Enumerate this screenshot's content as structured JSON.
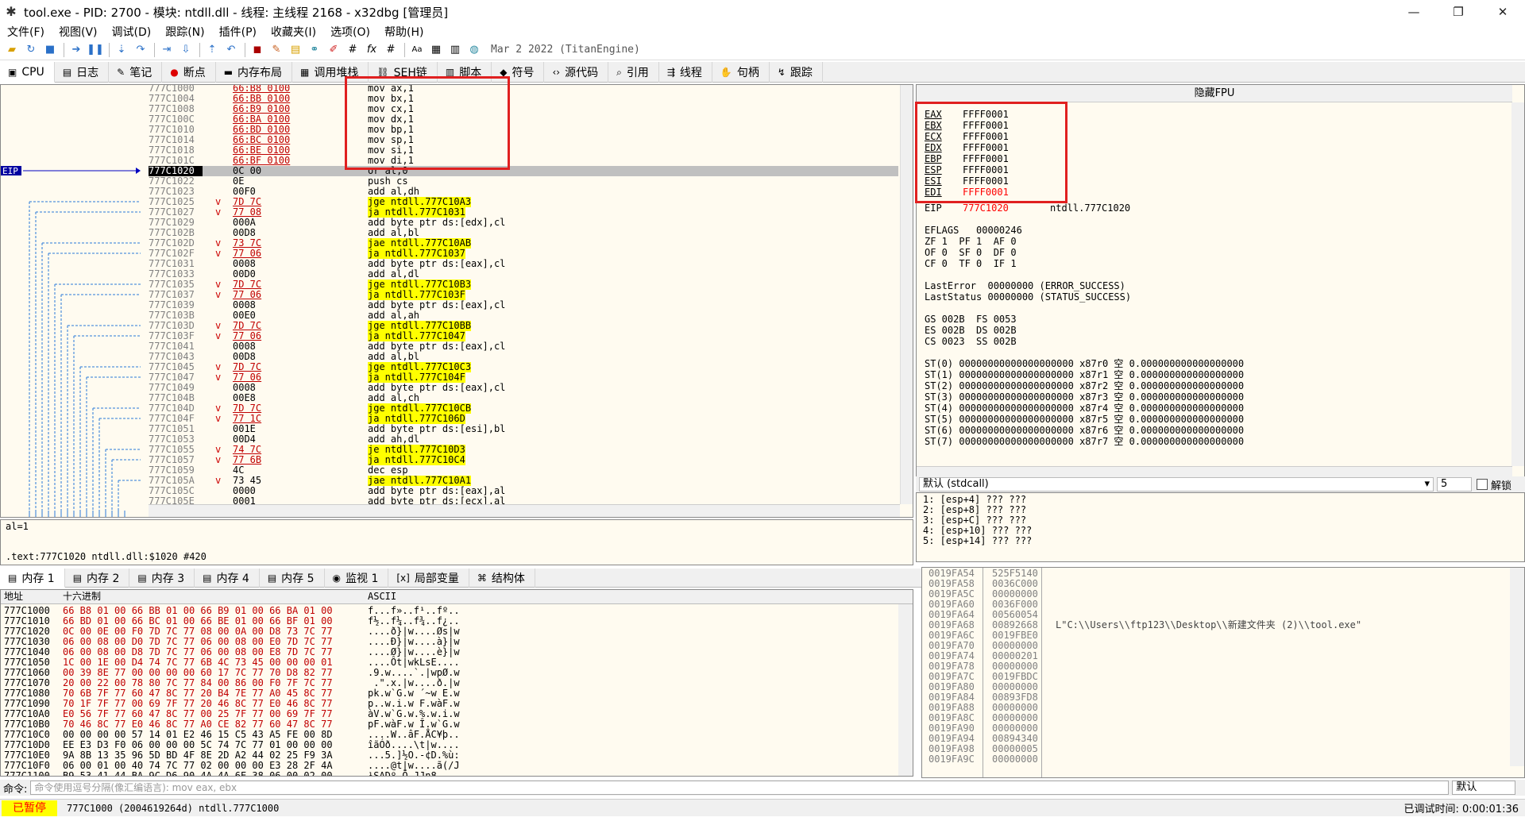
{
  "window": {
    "title": "tool.exe - PID: 2700 - 模块: ntdll.dll - 线程: 主线程 2168 - x32dbg [管理员]"
  },
  "menu": [
    "文件(F)",
    "视图(V)",
    "调试(D)",
    "跟踪(N)",
    "插件(P)",
    "收藏夹(I)",
    "选项(O)",
    "帮助(H)"
  ],
  "toolbar": {
    "build_date": "Mar 2 2022 (TitanEngine)"
  },
  "tabs": [
    {
      "label": "CPU",
      "icon": "cpu-icon"
    },
    {
      "label": "日志",
      "icon": "log-icon"
    },
    {
      "label": "笔记",
      "icon": "notes-icon"
    },
    {
      "label": "断点",
      "icon": "breakpoint-icon"
    },
    {
      "label": "内存布局",
      "icon": "memory-map-icon"
    },
    {
      "label": "调用堆栈",
      "icon": "callstack-icon"
    },
    {
      "label": "SEH链",
      "icon": "seh-icon"
    },
    {
      "label": "脚本",
      "icon": "script-icon"
    },
    {
      "label": "符号",
      "icon": "symbol-icon"
    },
    {
      "label": "源代码",
      "icon": "source-icon"
    },
    {
      "label": "引用",
      "icon": "reference-icon"
    },
    {
      "label": "线程",
      "icon": "thread-icon"
    },
    {
      "label": "句柄",
      "icon": "handle-icon"
    },
    {
      "label": "跟踪",
      "icon": "trace-icon"
    }
  ],
  "disasm": {
    "eip_label": "EIP",
    "rows": [
      {
        "addr": "777C1000",
        "arrow": "",
        "bytes": "66:B8 0100",
        "inst": "mov ax,1",
        "hl": true,
        "jmp": false
      },
      {
        "addr": "777C1004",
        "arrow": "",
        "bytes": "66:BB 0100",
        "inst": "mov bx,1",
        "hl": true,
        "jmp": false
      },
      {
        "addr": "777C1008",
        "arrow": "",
        "bytes": "66:B9 0100",
        "inst": "mov cx,1",
        "hl": true,
        "jmp": false
      },
      {
        "addr": "777C100C",
        "arrow": "",
        "bytes": "66:BA 0100",
        "inst": "mov dx,1",
        "hl": true,
        "jmp": false
      },
      {
        "addr": "777C1010",
        "arrow": "",
        "bytes": "66:BD 0100",
        "inst": "mov bp,1",
        "hl": true,
        "jmp": false
      },
      {
        "addr": "777C1014",
        "arrow": "",
        "bytes": "66:BC 0100",
        "inst": "mov sp,1",
        "hl": true,
        "jmp": false
      },
      {
        "addr": "777C1018",
        "arrow": "",
        "bytes": "66:BE 0100",
        "inst": "mov si,1",
        "hl": true,
        "jmp": false
      },
      {
        "addr": "777C101C",
        "arrow": "",
        "bytes": "66:BF 0100",
        "inst": "mov di,1",
        "hl": true,
        "jmp": false
      },
      {
        "addr": "777C1020",
        "arrow": "",
        "bytes": "0C 00",
        "inst": "or al,0",
        "hl": false,
        "jmp": false
      },
      {
        "addr": "777C1022",
        "arrow": "",
        "bytes": "0E",
        "inst": "push cs",
        "hl": false,
        "jmp": false
      },
      {
        "addr": "777C1023",
        "arrow": "",
        "bytes": "00F0",
        "inst": "add al,dh",
        "hl": false,
        "jmp": false
      },
      {
        "addr": "777C1025",
        "arrow": "v",
        "bytes": "7D 7C",
        "inst": "jge ntdll.777C10A3",
        "hl": true,
        "jmp": true
      },
      {
        "addr": "777C1027",
        "arrow": "v",
        "bytes": "77 08",
        "inst": "ja ntdll.777C1031",
        "hl": true,
        "jmp": true
      },
      {
        "addr": "777C1029",
        "arrow": "",
        "bytes": "000A",
        "inst": "add byte ptr ds:[edx],cl",
        "hl": false,
        "jmp": false
      },
      {
        "addr": "777C102B",
        "arrow": "",
        "bytes": "00D8",
        "inst": "add al,bl",
        "hl": false,
        "jmp": false
      },
      {
        "addr": "777C102D",
        "arrow": "v",
        "bytes": "73 7C",
        "inst": "jae ntdll.777C10AB",
        "hl": true,
        "jmp": true
      },
      {
        "addr": "777C102F",
        "arrow": "v",
        "bytes": "77 06",
        "inst": "ja ntdll.777C1037",
        "hl": true,
        "jmp": true
      },
      {
        "addr": "777C1031",
        "arrow": "",
        "bytes": "0008",
        "inst": "add byte ptr ds:[eax],cl",
        "hl": false,
        "jmp": false
      },
      {
        "addr": "777C1033",
        "arrow": "",
        "bytes": "00D0",
        "inst": "add al,dl",
        "hl": false,
        "jmp": false
      },
      {
        "addr": "777C1035",
        "arrow": "v",
        "bytes": "7D 7C",
        "inst": "jge ntdll.777C10B3",
        "hl": true,
        "jmp": true
      },
      {
        "addr": "777C1037",
        "arrow": "v",
        "bytes": "77 06",
        "inst": "ja ntdll.777C103F",
        "hl": true,
        "jmp": true
      },
      {
        "addr": "777C1039",
        "arrow": "",
        "bytes": "0008",
        "inst": "add byte ptr ds:[eax],cl",
        "hl": false,
        "jmp": false
      },
      {
        "addr": "777C103B",
        "arrow": "",
        "bytes": "00E0",
        "inst": "add al,ah",
        "hl": false,
        "jmp": false
      },
      {
        "addr": "777C103D",
        "arrow": "v",
        "bytes": "7D 7C",
        "inst": "jge ntdll.777C10BB",
        "hl": true,
        "jmp": true
      },
      {
        "addr": "777C103F",
        "arrow": "v",
        "bytes": "77 06",
        "inst": "ja ntdll.777C1047",
        "hl": true,
        "jmp": true
      },
      {
        "addr": "777C1041",
        "arrow": "",
        "bytes": "0008",
        "inst": "add byte ptr ds:[eax],cl",
        "hl": false,
        "jmp": false
      },
      {
        "addr": "777C1043",
        "arrow": "",
        "bytes": "00D8",
        "inst": "add al,bl",
        "hl": false,
        "jmp": false
      },
      {
        "addr": "777C1045",
        "arrow": "v",
        "bytes": "7D 7C",
        "inst": "jge ntdll.777C10C3",
        "hl": true,
        "jmp": true
      },
      {
        "addr": "777C1047",
        "arrow": "v",
        "bytes": "77 06",
        "inst": "ja ntdll.777C104F",
        "hl": true,
        "jmp": true
      },
      {
        "addr": "777C1049",
        "arrow": "",
        "bytes": "0008",
        "inst": "add byte ptr ds:[eax],cl",
        "hl": false,
        "jmp": false
      },
      {
        "addr": "777C104B",
        "arrow": "",
        "bytes": "00E8",
        "inst": "add al,ch",
        "hl": false,
        "jmp": false
      },
      {
        "addr": "777C104D",
        "arrow": "v",
        "bytes": "7D 7C",
        "inst": "jge ntdll.777C10CB",
        "hl": true,
        "jmp": true
      },
      {
        "addr": "777C104F",
        "arrow": "v",
        "bytes": "77 1C",
        "inst": "ja ntdll.777C106D",
        "hl": true,
        "jmp": true
      },
      {
        "addr": "777C1051",
        "arrow": "",
        "bytes": "001E",
        "inst": "add byte ptr ds:[esi],bl",
        "hl": false,
        "jmp": false
      },
      {
        "addr": "777C1053",
        "arrow": "",
        "bytes": "00D4",
        "inst": "add ah,dl",
        "hl": false,
        "jmp": false
      },
      {
        "addr": "777C1055",
        "arrow": "v",
        "bytes": "74 7C",
        "inst": "je ntdll.777C10D3",
        "hl": true,
        "jmp": true
      },
      {
        "addr": "777C1057",
        "arrow": "v",
        "bytes": "77 6B",
        "inst": "ja ntdll.777C10C4",
        "hl": true,
        "jmp": true
      },
      {
        "addr": "777C1059",
        "arrow": "",
        "bytes": "4C",
        "inst": "dec esp",
        "hl": false,
        "jmp": false
      },
      {
        "addr": "777C105A",
        "arrow": "v",
        "bytes": "73 45",
        "inst": "jae ntdll.777C10A1",
        "hl": false,
        "jmp": true
      },
      {
        "addr": "777C105C",
        "arrow": "",
        "bytes": "0000",
        "inst": "add byte ptr ds:[eax],al",
        "hl": false,
        "jmp": false
      },
      {
        "addr": "777C105E",
        "arrow": "",
        "bytes": "0001",
        "inst": "add byte ptr ds:[ecx],al",
        "hl": false,
        "jmp": false
      }
    ]
  },
  "info": {
    "line1": "al=1",
    "line2": ".text:777C1020 ntdll.dll:$1020 #420"
  },
  "registers": {
    "header": "隐藏FPU",
    "gpr": [
      {
        "name": "EAX",
        "value": "FFFF0001",
        "changed": false
      },
      {
        "name": "EBX",
        "value": "FFFF0001",
        "changed": false
      },
      {
        "name": "ECX",
        "value": "FFFF0001",
        "changed": false
      },
      {
        "name": "EDX",
        "value": "FFFF0001",
        "changed": false
      },
      {
        "name": "EBP",
        "value": "FFFF0001",
        "changed": false
      },
      {
        "name": "ESP",
        "value": "FFFF0001",
        "changed": false
      },
      {
        "name": "ESI",
        "value": "FFFF0001",
        "changed": false
      },
      {
        "name": "EDI",
        "value": "FFFF0001",
        "changed": true
      }
    ],
    "eip": {
      "name": "EIP",
      "value": "777C1020",
      "comment": "ntdll.777C1020"
    },
    "eflags": "EFLAGS   00000246",
    "flags1": "ZF 1  PF 1  AF 0",
    "flags2": "OF 0  SF 0  DF 0",
    "flags3": "CF 0  TF 0  IF 1",
    "lasterror": "LastError  00000000 (ERROR_SUCCESS)",
    "laststatus": "LastStatus 00000000 (STATUS_SUCCESS)",
    "seg1": "GS 002B  FS 0053",
    "seg2": "ES 002B  DS 002B",
    "seg3": "CS 0023  SS 002B",
    "fpu": [
      "ST(0) 00000000000000000000 x87r0 空 0.000000000000000000",
      "ST(1) 00000000000000000000 x87r1 空 0.000000000000000000",
      "ST(2) 00000000000000000000 x87r2 空 0.000000000000000000",
      "ST(3) 00000000000000000000 x87r3 空 0.000000000000000000",
      "ST(4) 00000000000000000000 x87r4 空 0.000000000000000000",
      "ST(5) 00000000000000000000 x87r5 空 0.000000000000000000",
      "ST(6) 00000000000000000000 x87r6 空 0.000000000000000000",
      "ST(7) 00000000000000000000 x87r7 空 0.000000000000000000"
    ]
  },
  "callstack": {
    "convention": "默认 (stdcall)",
    "count": "5",
    "lock_label": "解锁",
    "rows": [
      "1: [esp+4] ??? ???",
      "2: [esp+8] ??? ???",
      "3: [esp+C] ??? ???",
      "4: [esp+10] ??? ???",
      "5: [esp+14] ??? ???"
    ]
  },
  "bottom_tabs": [
    {
      "label": "内存 1",
      "icon": "memory-icon"
    },
    {
      "label": "内存 2",
      "icon": "memory-icon"
    },
    {
      "label": "内存 3",
      "icon": "memory-icon"
    },
    {
      "label": "内存 4",
      "icon": "memory-icon"
    },
    {
      "label": "内存 5",
      "icon": "memory-icon"
    },
    {
      "label": "监视 1",
      "icon": "watch-icon"
    },
    {
      "label": "局部变量",
      "icon": "locals-icon"
    },
    {
      "label": "结构体",
      "icon": "struct-icon"
    }
  ],
  "dump": {
    "headers": {
      "addr": "地址",
      "hex": "十六进制",
      "ascii": "ASCII"
    },
    "rows": [
      {
        "addr": "777C1000",
        "hex": "66 B8 01 00 66 BB 01 00 66 B9 01 00 66 BA 01 00",
        "ascii": "f...f»..f¹..fº.."
      },
      {
        "addr": "777C1010",
        "hex": "66 BD 01 00 66 BC 01 00 66 BE 01 00 66 BF 01 00",
        "ascii": "f½..f¼..f¾..f¿.."
      },
      {
        "addr": "777C1020",
        "hex": "0C 00 0E 00 F0 7D 7C 77 08 00 0A 00 D8 73 7C 77",
        "ascii": "....ð}|w....Øs|w"
      },
      {
        "addr": "777C1030",
        "hex": "06 00 08 00 D0 7D 7C 77 06 00 08 00 E0 7D 7C 77",
        "ascii": "....Ð}|w....à}|w"
      },
      {
        "addr": "777C1040",
        "hex": "06 00 08 00 D8 7D 7C 77 06 00 08 00 E8 7D 7C 77",
        "ascii": "....Ø}|w....è}|w"
      },
      {
        "addr": "777C1050",
        "hex": "1C 00 1E 00 D4 74 7C 77 6B 4C 73 45 00 00 00 01",
        "ascii": "....Ôt|wkLsE...."
      },
      {
        "addr": "777C1060",
        "hex": "00 39 8E 77 00 00 00 00 60 17 7C 77 70 D8 82 77",
        "ascii": ".9.w....`.|wpØ.w"
      },
      {
        "addr": "777C1070",
        "hex": "20 00 22 00 78 80 7C 77 84 00 86 00 F0 7F 7C 77",
        "ascii": " .\".x.|w....ð.|w"
      },
      {
        "addr": "777C1080",
        "hex": "70 6B 7F 77 60 47 8C 77 20 B4 7E 77 A0 45 8C 77",
        "ascii": "pk.w`G.w ´~w E.w"
      },
      {
        "addr": "777C1090",
        "hex": "70 1F 7F 77 00 69 7F 77 20 46 8C 77 E0 46 8C 77",
        "ascii": "p..w.i.w F.wàF.w"
      },
      {
        "addr": "777C10A0",
        "hex": "E0 56 7F 77 60 47 8C 77 00 25 7F 77 00 69 7F 77",
        "ascii": "àV.w`G.w.%.w.i.w"
      },
      {
        "addr": "777C10B0",
        "hex": "70 46 8C 77 E0 46 8C 77 A0 CE 82 77 60 47 8C 77",
        "ascii": "pF.wàF.w Î.w`G.w"
      },
      {
        "addr": "777C10C0",
        "hex": "00 00 00 00 57 14 01 E2 46 15 C5 43 A5 FE 00 8D",
        "ascii": "....W..âF.ÅC¥þ.."
      },
      {
        "addr": "777C10D0",
        "hex": "EE E3 D3 F0 06 00 00 00 5C 74 7C 77 01 00 00 00",
        "ascii": "îãÓð....\\t|w...."
      },
      {
        "addr": "777C10E0",
        "hex": "9A 8B 13 35 96 5D BD 4F 8E 2D A2 44 02 25 F9 3A",
        "ascii": "...5.]½O.-¢D.%ù:"
      },
      {
        "addr": "777C10F0",
        "hex": "06 00 01 00 40 74 7C 77 02 00 00 00 E3 28 2F 4A",
        "ascii": "....@t|w....ã(/J"
      },
      {
        "addr": "777C1100",
        "hex": "B9 53 41 44 BA 9C D6 90 4A 4A 6E 38 06 00 02 00",
        "ascii": "¹SADº.Ö.JJn8...."
      }
    ]
  },
  "stack": {
    "rows": [
      {
        "addr": "0019FA54",
        "val": "525F5140",
        "comment": ""
      },
      {
        "addr": "0019FA58",
        "val": "0036C000",
        "comment": ""
      },
      {
        "addr": "0019FA5C",
        "val": "00000000",
        "comment": ""
      },
      {
        "addr": "0019FA60",
        "val": "0036F000",
        "comment": ""
      },
      {
        "addr": "0019FA64",
        "val": "00560054",
        "comment": ""
      },
      {
        "addr": "0019FA68",
        "val": "00892668",
        "comment": "L\"C:\\\\Users\\\\ftp123\\\\Desktop\\\\新建文件夹 (2)\\\\tool.exe\""
      },
      {
        "addr": "0019FA6C",
        "val": "0019FBE0",
        "comment": ""
      },
      {
        "addr": "0019FA70",
        "val": "00000000",
        "comment": ""
      },
      {
        "addr": "0019FA74",
        "val": "00000201",
        "comment": ""
      },
      {
        "addr": "0019FA78",
        "val": "00000000",
        "comment": ""
      },
      {
        "addr": "0019FA7C",
        "val": "0019FBDC",
        "comment": ""
      },
      {
        "addr": "0019FA80",
        "val": "00000000",
        "comment": ""
      },
      {
        "addr": "0019FA84",
        "val": "00893FD8",
        "comment": ""
      },
      {
        "addr": "0019FA88",
        "val": "00000000",
        "comment": ""
      },
      {
        "addr": "0019FA8C",
        "val": "00000000",
        "comment": ""
      },
      {
        "addr": "0019FA90",
        "val": "00000000",
        "comment": ""
      },
      {
        "addr": "0019FA94",
        "val": "00894340",
        "comment": ""
      },
      {
        "addr": "0019FA98",
        "val": "00000005",
        "comment": ""
      },
      {
        "addr": "0019FA9C",
        "val": "00000000",
        "comment": ""
      }
    ]
  },
  "command": {
    "label": "命令:",
    "placeholder": "命令使用逗号分隔(像汇编语言): mov eax, ebx",
    "mode": "默认"
  },
  "status": {
    "state": "已暂停",
    "message": "777C1000 (2004619264d) ntdll.777C1000",
    "timer": "已调试时间: 0:00:01:36"
  },
  "colors": {
    "accent_red": "#e02020",
    "paused_bg": "#ffff00",
    "jump_highlight": "#ffff00"
  }
}
